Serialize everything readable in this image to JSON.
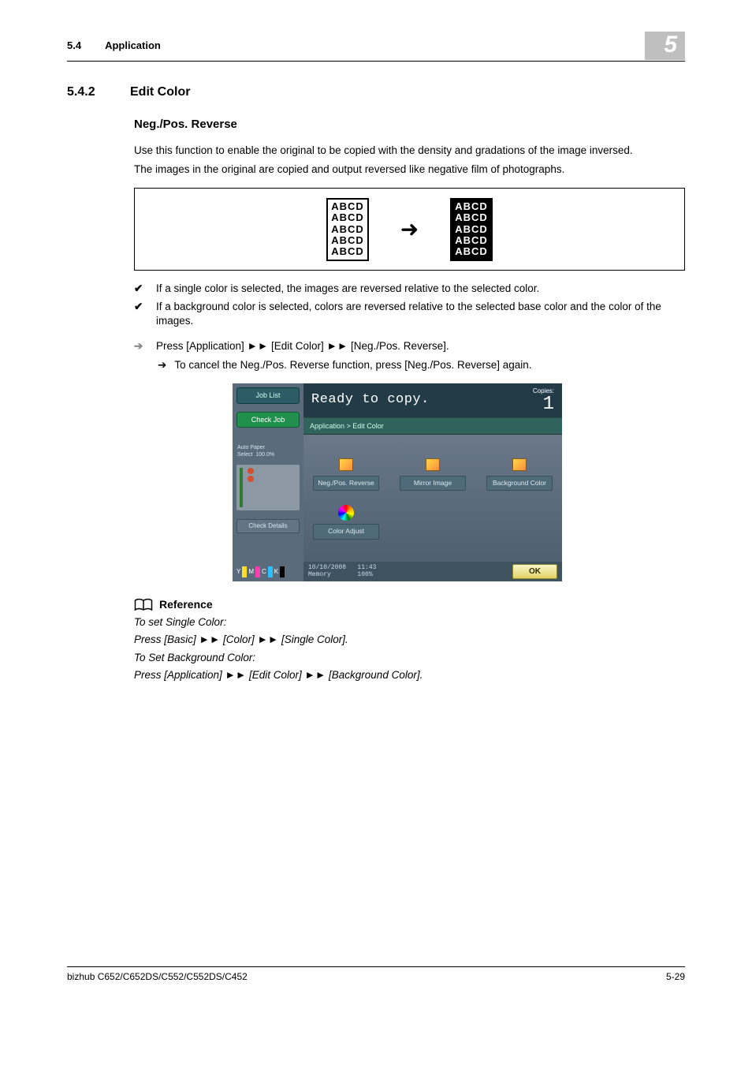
{
  "header": {
    "section_num": "5.4",
    "section_name": "Application",
    "chapter": "5"
  },
  "heading": {
    "num": "5.4.2",
    "title": "Edit Color"
  },
  "subheading": "Neg./Pos. Reverse",
  "intro": {
    "p1": "Use this function to enable the original to be copied with the density and gradations of the image inversed.",
    "p2": "The images in the original are copied and output reversed like negative film of photographs."
  },
  "diagram": {
    "left_lines": [
      "ABCD",
      "ABCD",
      "ABCD",
      "ABCD",
      "ABCD"
    ],
    "right_lines": [
      "ABCD",
      "ABCD",
      "ABCD",
      "ABCD",
      "ABCD"
    ]
  },
  "bullets": {
    "b1": "If a single color is selected, the images are reversed relative to the selected color.",
    "b2": "If a background color is selected, colors are reversed relative to the selected base color and the color of the images."
  },
  "steps": {
    "s1": "Press [Application] ►► [Edit Color] ►► [Neg./Pos. Reverse].",
    "sub1": "To cancel the Neg./Pos. Reverse function, press [Neg./Pos. Reverse] again."
  },
  "ui": {
    "side": {
      "job_list": "Job List",
      "check_job": "Check Job",
      "auto_paper": "Auto Paper Select",
      "zoom": "100.0%",
      "check_details": "Check Details",
      "toner_labels": [
        "Y",
        "M",
        "C",
        "K"
      ]
    },
    "status": {
      "msg": "Ready to copy.",
      "copies_label": "Copies:",
      "copies_count": "1"
    },
    "breadcrumb": "Application > Edit Color",
    "options": {
      "neg_pos": "Neg./Pos. Reverse",
      "mirror": "Mirror Image",
      "bg_color": "Background Color",
      "color_adjust": "Color Adjust"
    },
    "bottom": {
      "date": "10/10/2008",
      "time": "11:43",
      "mem_label": "Memory",
      "mem_val": "100%",
      "ok": "OK"
    }
  },
  "reference": {
    "title": "Reference",
    "l1": "To set Single Color:",
    "l2": "Press [Basic] ►► [Color] ►► [Single Color].",
    "l3": "To Set Background Color:",
    "l4": "Press [Application] ►► [Edit Color] ►► [Background Color]."
  },
  "footer": {
    "model": "bizhub C652/C652DS/C552/C552DS/C452",
    "page": "5-29"
  }
}
